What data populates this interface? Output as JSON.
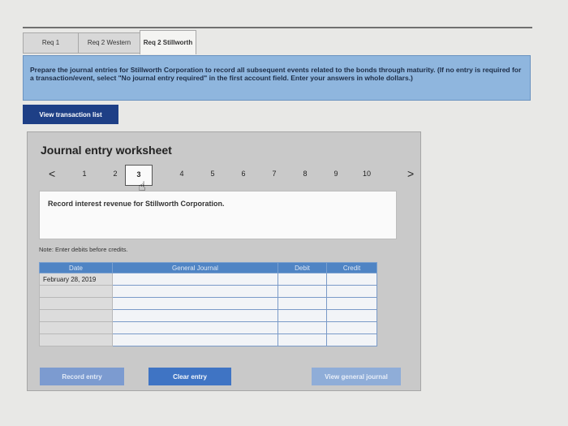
{
  "tabs": [
    {
      "label": "Req 1"
    },
    {
      "label": "Req 2 Western"
    },
    {
      "label": "Req 2 Stillworth"
    }
  ],
  "instructions": "Prepare the journal entries for Stillworth Corporation to record all subsequent events related to the bonds through maturity. (If no entry is required for a transaction/event, select \"No journal entry required\" in the first account field. Enter your answers in whole dollars.)",
  "view_transaction_list_label": "View transaction list",
  "worksheet": {
    "title": "Journal entry worksheet",
    "pager": {
      "prev": "<",
      "next": ">",
      "pages": [
        "1",
        "2",
        "3",
        "4",
        "5",
        "6",
        "7",
        "8",
        "9",
        "10"
      ],
      "active_page": "3"
    },
    "description": "Record interest revenue for Stillworth Corporation.",
    "note": "Note: Enter debits before credits.",
    "columns": {
      "date": "Date",
      "general_journal": "General Journal",
      "debit": "Debit",
      "credit": "Credit"
    },
    "rows": [
      {
        "date": "February 28, 2019"
      },
      {
        "date": ""
      },
      {
        "date": ""
      },
      {
        "date": ""
      },
      {
        "date": ""
      },
      {
        "date": ""
      }
    ]
  },
  "buttons": {
    "record": "Record entry",
    "clear": "Clear entry",
    "view_journal": "View general journal"
  }
}
